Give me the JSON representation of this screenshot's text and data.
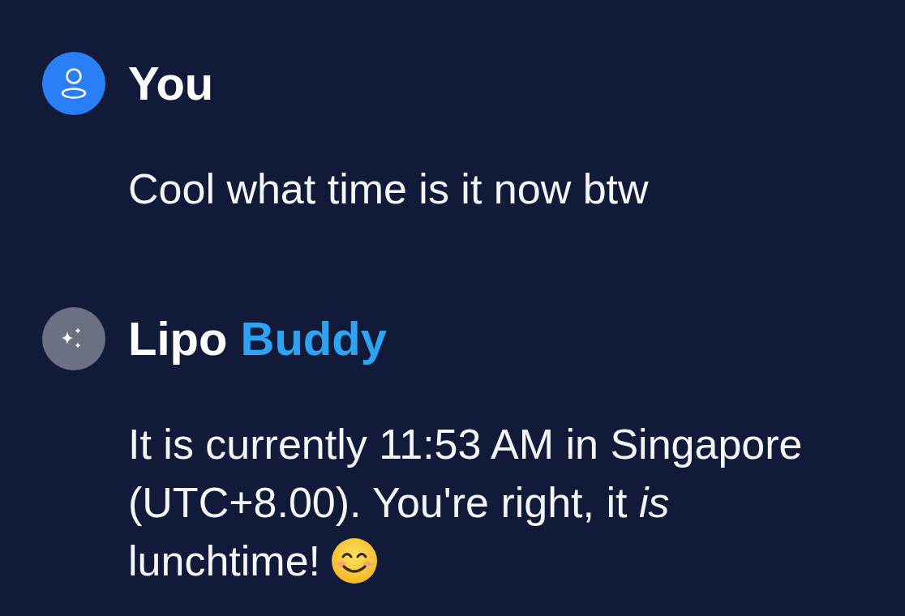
{
  "messages": [
    {
      "kind": "user",
      "sender": [
        {
          "text": "You",
          "accent": false
        }
      ],
      "text": "Cool what time is it now btw",
      "emoji": false
    },
    {
      "kind": "assistant",
      "sender": [
        {
          "text": "Lipo",
          "accent": false
        },
        {
          "text": "Buddy",
          "accent": true
        }
      ],
      "text": "It is currently 11:53 AM in Singapore (UTC+8.00). You're right, it *is* lunchtime!",
      "emoji": true
    }
  ]
}
